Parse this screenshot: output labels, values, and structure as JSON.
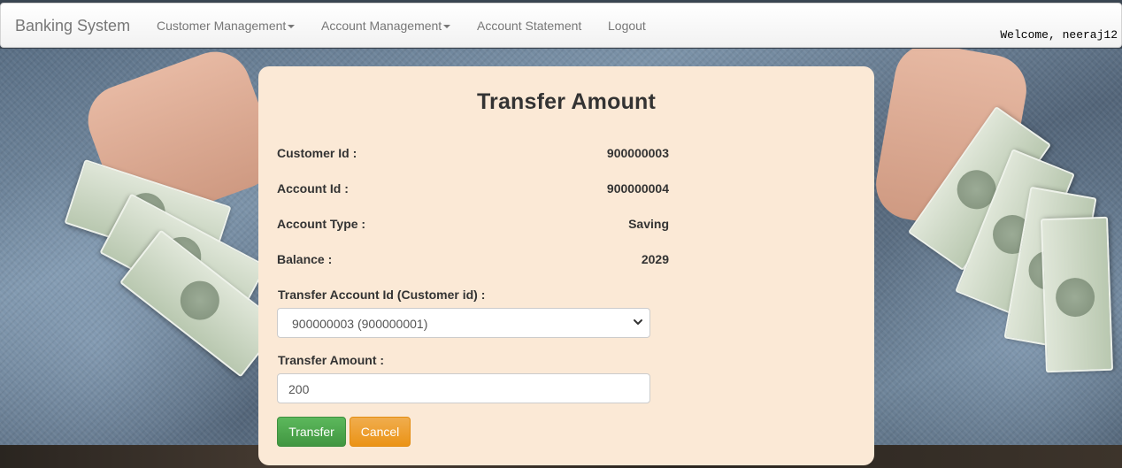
{
  "navbar": {
    "brand": "Banking System",
    "items": [
      {
        "label": "Customer Management",
        "dropdown": true
      },
      {
        "label": "Account Management",
        "dropdown": true
      },
      {
        "label": "Account Statement",
        "dropdown": false
      },
      {
        "label": "Logout",
        "dropdown": false
      }
    ],
    "welcome": "Welcome, neeraj12"
  },
  "form": {
    "title": "Transfer Amount",
    "info": [
      {
        "label": "Customer Id :",
        "value": "900000003"
      },
      {
        "label": "Account Id :",
        "value": "900000004"
      },
      {
        "label": "Account Type :",
        "value": "Saving"
      },
      {
        "label": "Balance :",
        "value": "2029"
      }
    ],
    "transfer_account_label": "Transfer Account Id (Customer id) :",
    "transfer_account_selected": "900000003 (900000001)",
    "transfer_amount_label": "Transfer Amount :",
    "transfer_amount_value": "200",
    "transfer_button": "Transfer",
    "cancel_button": "Cancel"
  },
  "colors": {
    "card_background": "#fbe9d6",
    "transfer_button": "#5cb85c",
    "cancel_button": "#f0ad4e"
  },
  "icons": {
    "select_arrow": "chevron-down-icon",
    "nav_dropdown": "caret-down-icon"
  }
}
